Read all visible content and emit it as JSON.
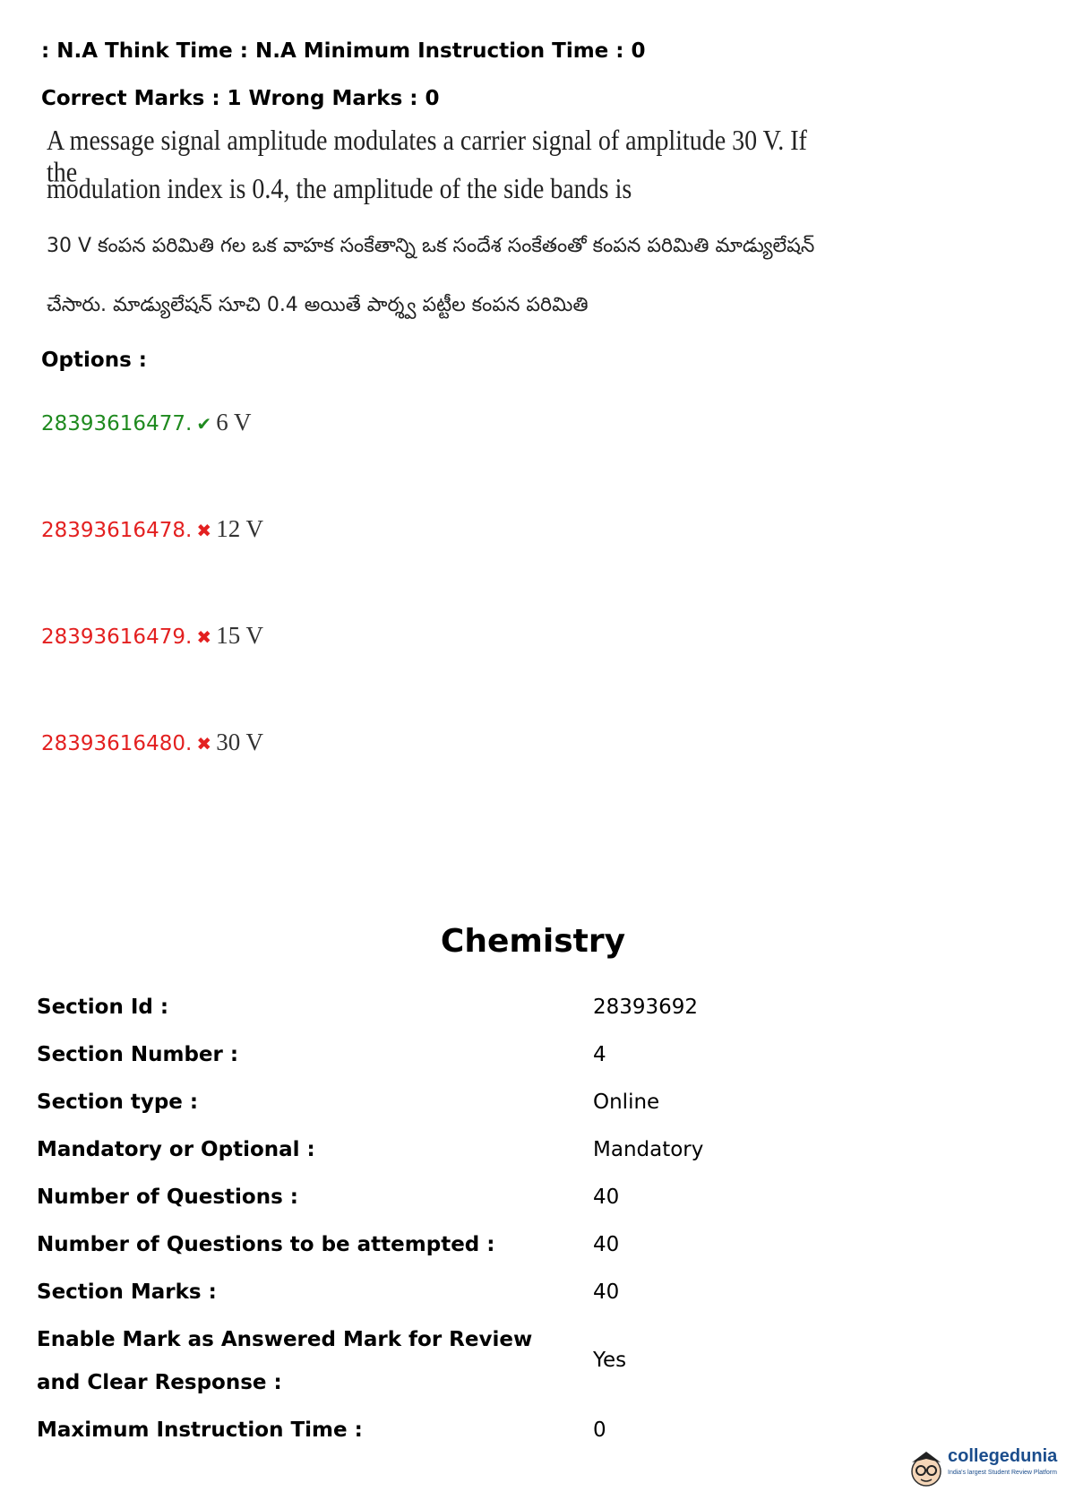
{
  "header": {
    "line1": ": N.A Think Time : N.A Minimum Instruction Time : 0",
    "line2": "Correct Marks : 1 Wrong Marks : 0"
  },
  "question": {
    "english_line1": "A message signal amplitude modulates a carrier signal of amplitude 30 V. If the",
    "english_line2": "modulation index is 0.4, the amplitude of the side bands is",
    "telugu_line1": "30 V కంపన పరిమితి గల ఒక వాహక సంకేతాన్ని ఒక సందేశ సంకేతంతో కంపన పరిమితి మాడ్యులేషన్",
    "telugu_line2": "చేసారు. మాడ్యులేషన్ సూచి 0.4 అయితే పార్శ్వ పట్టీల కంపన పరిమితి"
  },
  "options_label": "Options :",
  "options": [
    {
      "id": "28393616477.",
      "value": "6 V",
      "status": "correct",
      "mark": "✔",
      "color": "#1f8a1f"
    },
    {
      "id": "28393616478.",
      "value": "12 V",
      "status": "wrong",
      "mark": "✖",
      "color": "#e32020"
    },
    {
      "id": "28393616479.",
      "value": "15 V",
      "status": "wrong",
      "mark": "✖",
      "color": "#e32020"
    },
    {
      "id": "28393616480.",
      "value": "30 V",
      "status": "wrong",
      "mark": "✖",
      "color": "#e32020"
    }
  ],
  "section": {
    "title": "Chemistry",
    "rows": [
      {
        "label": "Section Id :",
        "value": "28393692"
      },
      {
        "label": "Section Number :",
        "value": "4"
      },
      {
        "label": "Section type :",
        "value": "Online"
      },
      {
        "label": "Mandatory or Optional :",
        "value": "Mandatory"
      },
      {
        "label": "Number of Questions :",
        "value": "40"
      },
      {
        "label": "Number of Questions to be attempted :",
        "value": "40"
      },
      {
        "label": "Section Marks :",
        "value": "40"
      },
      {
        "label": "Enable Mark as Answered Mark for Review and Clear Response :",
        "value": "Yes"
      },
      {
        "label": "Maximum Instruction Time :",
        "value": "0"
      }
    ]
  },
  "logo": {
    "name": "collegedunia",
    "tagline": "India's largest Student Review Platform",
    "accent": "#1b4d8c"
  }
}
